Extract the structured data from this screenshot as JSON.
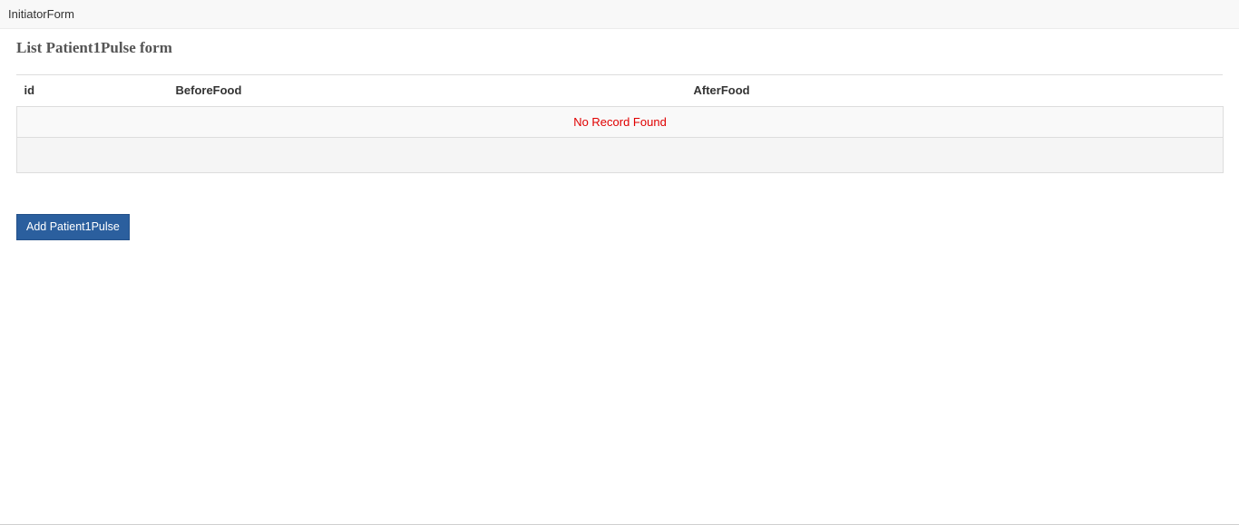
{
  "navbar": {
    "brand": "InitiatorForm"
  },
  "main": {
    "title": "List Patient1Pulse form",
    "table": {
      "columns": [
        "id",
        "BeforeFood",
        "AfterFood"
      ],
      "empty_message": "No Record Found"
    },
    "add_button_label": "Add Patient1Pulse"
  },
  "colors": {
    "primary_button": "#2b5f9e",
    "empty_message": "#e00000"
  }
}
